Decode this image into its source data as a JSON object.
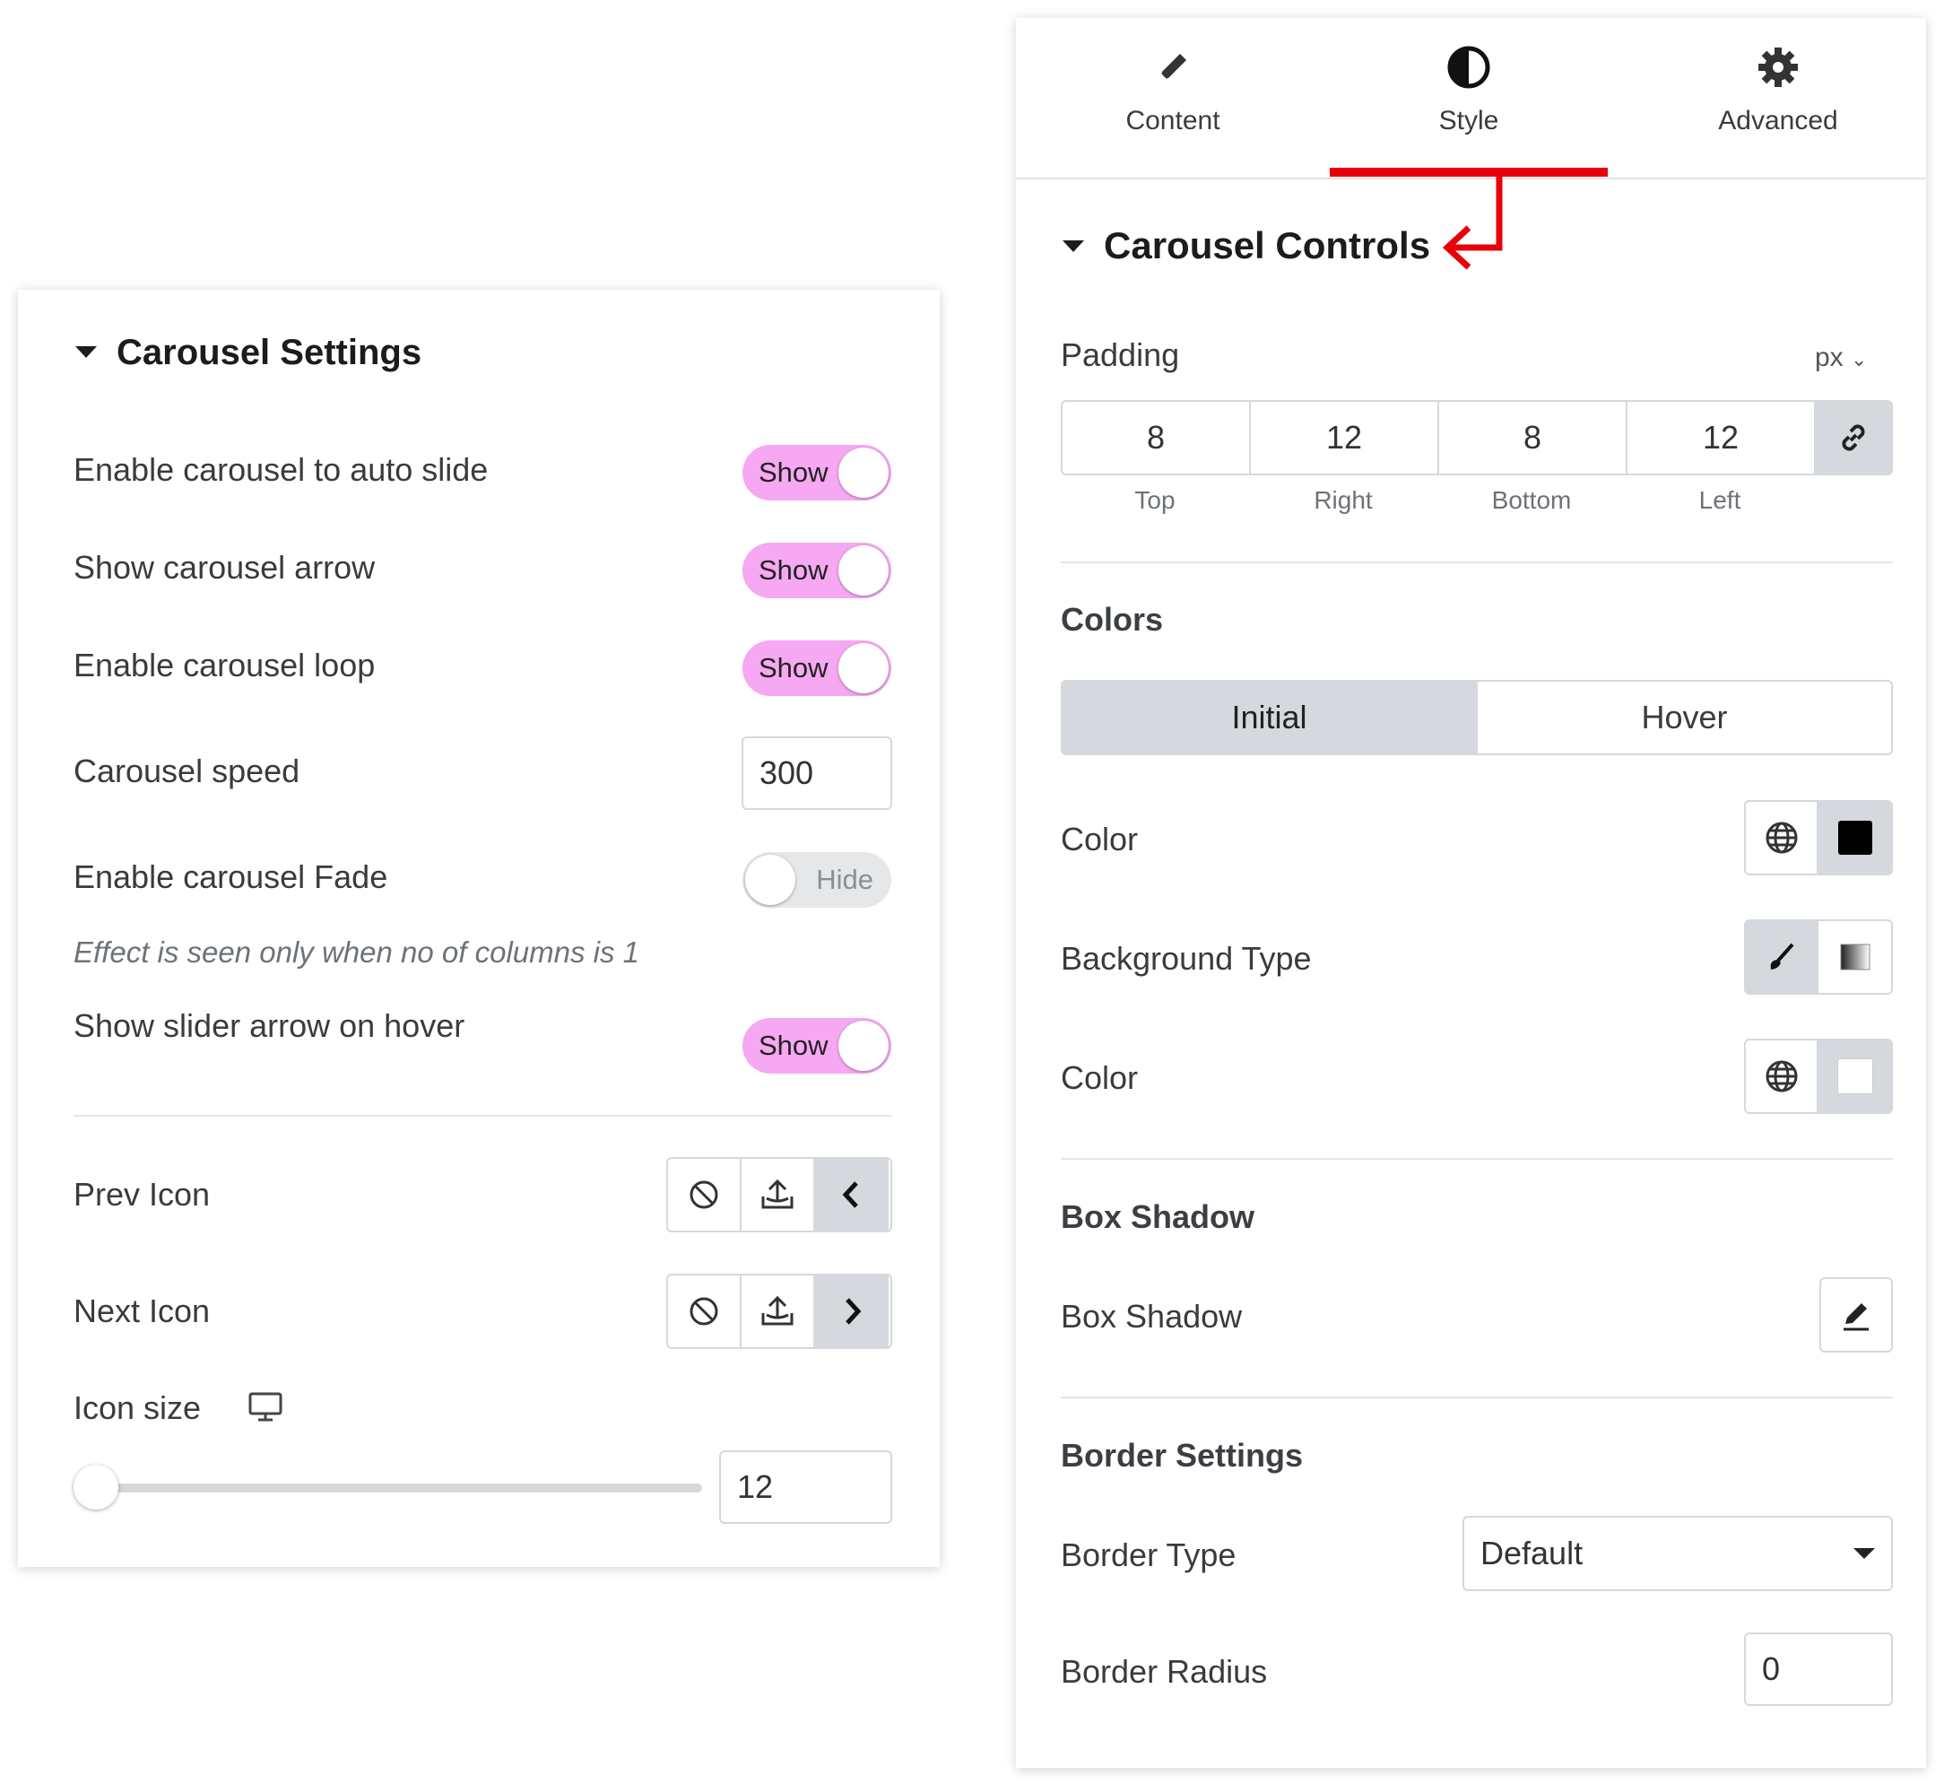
{
  "left_panel": {
    "title": "Carousel Settings",
    "rows": {
      "auto_slide": {
        "label": "Enable carousel to auto slide",
        "state": "Show"
      },
      "arrow": {
        "label": "Show carousel arrow",
        "state": "Show"
      },
      "loop": {
        "label": "Enable carousel loop",
        "state": "Show"
      },
      "speed": {
        "label": "Carousel speed",
        "value": "300"
      },
      "fade": {
        "label": "Enable carousel Fade",
        "state": "Hide"
      },
      "fade_note": "Effect is seen only when no of columns is 1",
      "hover_arrow": {
        "label": "Show slider arrow on hover",
        "state": "Show"
      }
    },
    "prev_icon": {
      "label": "Prev Icon"
    },
    "next_icon": {
      "label": "Next Icon"
    },
    "icon_size": {
      "label": "Icon size",
      "value": "12",
      "slider_fraction": 0.0
    }
  },
  "right_panel": {
    "tabs": [
      {
        "label": "Content",
        "icon": "pencil-icon"
      },
      {
        "label": "Style",
        "icon": "contrast-icon"
      },
      {
        "label": "Advanced",
        "icon": "gear-icon"
      }
    ],
    "active_tab": "Style",
    "title": "Carousel Controls",
    "padding": {
      "label": "Padding",
      "unit": "px",
      "values": [
        {
          "value": "8",
          "label": "Top"
        },
        {
          "value": "12",
          "label": "Right"
        },
        {
          "value": "8",
          "label": "Bottom"
        },
        {
          "value": "12",
          "label": "Left"
        }
      ]
    },
    "colors": {
      "heading": "Colors",
      "state_tabs": [
        "Initial",
        "Hover"
      ],
      "active_state": "Initial",
      "color1_label": "Color",
      "bg_type_label": "Background Type",
      "color2_label": "Color",
      "color1_swatch": "#000000",
      "color2_swatch": "#ffffff"
    },
    "box_shadow": {
      "heading": "Box Shadow",
      "label": "Box Shadow"
    },
    "border": {
      "heading": "Border Settings",
      "type_label": "Border Type",
      "type_value": "Default",
      "radius_label": "Border Radius",
      "radius_value": "0"
    }
  },
  "colors": {
    "toggle_on": "#f6a8f2",
    "annotation": "#e8000b"
  }
}
